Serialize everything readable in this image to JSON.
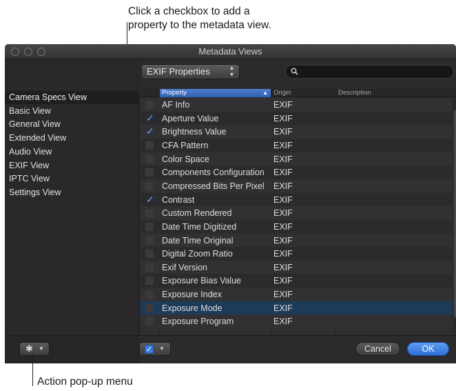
{
  "callouts": {
    "top_line1": "Click a checkbox to add a",
    "top_line2": "property to the metadata view.",
    "bottom": "Action pop-up menu"
  },
  "window": {
    "title": "Metadata Views"
  },
  "toolbar": {
    "properties_popup": "EXIF Properties",
    "search_placeholder": ""
  },
  "sidebar": {
    "items": [
      {
        "label": "Camera Specs View",
        "selected": true
      },
      {
        "label": "Basic View",
        "selected": false
      },
      {
        "label": "General View",
        "selected": false
      },
      {
        "label": "Extended View",
        "selected": false
      },
      {
        "label": "Audio View",
        "selected": false
      },
      {
        "label": "EXIF View",
        "selected": false
      },
      {
        "label": "IPTC View",
        "selected": false
      },
      {
        "label": "Settings View",
        "selected": false
      }
    ]
  },
  "table": {
    "columns": [
      "Property",
      "Origin",
      "Description"
    ],
    "rows": [
      {
        "property": "AF Info",
        "origin": "EXIF",
        "checked": false
      },
      {
        "property": "Aperture Value",
        "origin": "EXIF",
        "checked": true
      },
      {
        "property": "Brightness Value",
        "origin": "EXIF",
        "checked": true
      },
      {
        "property": "CFA Pattern",
        "origin": "EXIF",
        "checked": false
      },
      {
        "property": "Color Space",
        "origin": "EXIF",
        "checked": false
      },
      {
        "property": "Components Configuration",
        "origin": "EXIF",
        "checked": false
      },
      {
        "property": "Compressed Bits Per Pixel",
        "origin": "EXIF",
        "checked": false
      },
      {
        "property": "Contrast",
        "origin": "EXIF",
        "checked": true
      },
      {
        "property": "Custom Rendered",
        "origin": "EXIF",
        "checked": false
      },
      {
        "property": "Date Time Digitized",
        "origin": "EXIF",
        "checked": false
      },
      {
        "property": "Date Time Original",
        "origin": "EXIF",
        "checked": false
      },
      {
        "property": "Digital Zoom Ratio",
        "origin": "EXIF",
        "checked": false
      },
      {
        "property": "Exif Version",
        "origin": "EXIF",
        "checked": false
      },
      {
        "property": "Exposure Bias Value",
        "origin": "EXIF",
        "checked": false
      },
      {
        "property": "Exposure Index",
        "origin": "EXIF",
        "checked": false
      },
      {
        "property": "Exposure Mode",
        "origin": "EXIF",
        "checked": false,
        "selected": true
      },
      {
        "property": "Exposure Program",
        "origin": "EXIF",
        "checked": false
      }
    ]
  },
  "bottom": {
    "cancel_label": "Cancel",
    "ok_label": "OK"
  },
  "colors": {
    "accent": "#3c7be2",
    "checkmark": "#6aa8ff",
    "selected_row": "#1e3a5a"
  },
  "icons": {
    "action": "gear-icon",
    "search": "search-icon",
    "check": "checkmark-icon"
  }
}
